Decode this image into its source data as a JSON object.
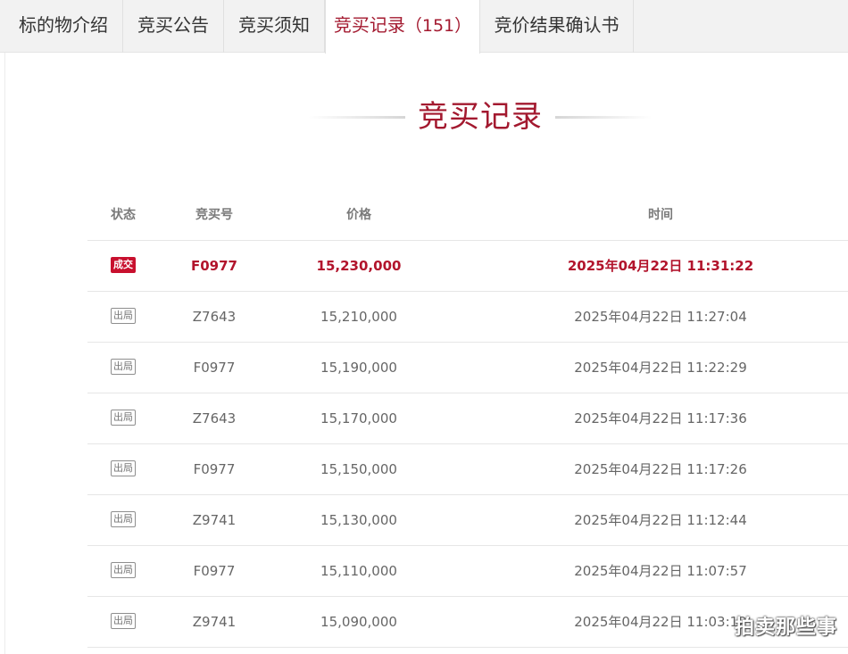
{
  "tabs": [
    {
      "label": "标的物介绍",
      "count": ""
    },
    {
      "label": "竞买公告",
      "count": ""
    },
    {
      "label": "竞买须知",
      "count": ""
    },
    {
      "label": "竞买记录",
      "count": "151"
    },
    {
      "label": "竞价结果确认书",
      "count": ""
    }
  ],
  "active_tab_index": 3,
  "section_title": "竞买记录",
  "table": {
    "headers": {
      "status": "状态",
      "bid_no": "竞买号",
      "price": "价格",
      "time": "时间"
    },
    "rows": [
      {
        "status": "成交",
        "bid_no": "F0977",
        "price": "15,230,000",
        "time": "2025年04月22日 11:31:22"
      },
      {
        "status": "出局",
        "bid_no": "Z7643",
        "price": "15,210,000",
        "time": "2025年04月22日 11:27:04"
      },
      {
        "status": "出局",
        "bid_no": "F0977",
        "price": "15,190,000",
        "time": "2025年04月22日 11:22:29"
      },
      {
        "status": "出局",
        "bid_no": "Z7643",
        "price": "15,170,000",
        "time": "2025年04月22日 11:17:36"
      },
      {
        "status": "出局",
        "bid_no": "F0977",
        "price": "15,150,000",
        "time": "2025年04月22日 11:17:26"
      },
      {
        "status": "出局",
        "bid_no": "Z9741",
        "price": "15,130,000",
        "time": "2025年04月22日 11:12:44"
      },
      {
        "status": "出局",
        "bid_no": "F0977",
        "price": "15,110,000",
        "time": "2025年04月22日 11:07:57"
      },
      {
        "status": "出局",
        "bid_no": "Z9741",
        "price": "15,090,000",
        "time": "2025年04月22日 11:03:12"
      }
    ]
  },
  "watermark": "拍卖那些事",
  "colors": {
    "accent": "#a3192f",
    "win_badge": "#c8102e",
    "tab_bar_bg": "#f2f2f2"
  }
}
